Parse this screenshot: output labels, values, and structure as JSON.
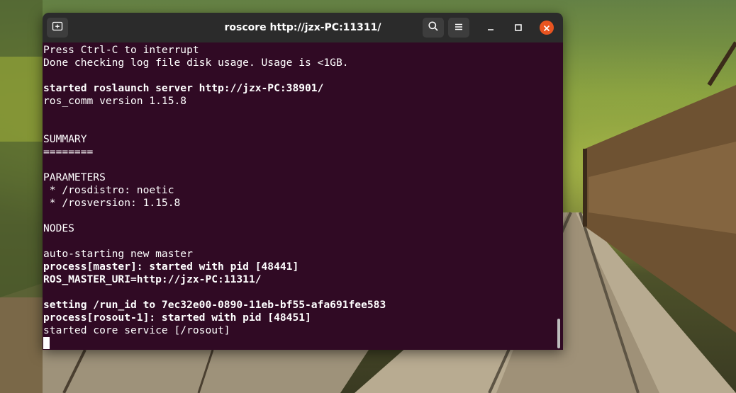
{
  "window": {
    "title": "roscore http://jzx-PC:11311/",
    "new_tab_icon": "new-tab-icon",
    "search_icon": "search-icon",
    "menu_icon": "hamburger-menu-icon",
    "minimize_icon": "minimize-icon",
    "maximize_icon": "maximize-icon",
    "close_icon": "close-icon",
    "close_color": "#e95420"
  },
  "terminal": {
    "background": "#300a24",
    "lines": [
      {
        "text": "Press Ctrl-C to interrupt",
        "bold": false
      },
      {
        "text": "Done checking log file disk usage. Usage is <1GB.",
        "bold": false
      },
      {
        "text": "",
        "bold": false
      },
      {
        "text": "started roslaunch server http://jzx-PC:38901/",
        "bold": true
      },
      {
        "text": "ros_comm version 1.15.8",
        "bold": false
      },
      {
        "text": "",
        "bold": false
      },
      {
        "text": "",
        "bold": false
      },
      {
        "text": "SUMMARY",
        "bold": false
      },
      {
        "text": "========",
        "bold": false
      },
      {
        "text": "",
        "bold": false
      },
      {
        "text": "PARAMETERS",
        "bold": false
      },
      {
        "text": " * /rosdistro: noetic",
        "bold": false
      },
      {
        "text": " * /rosversion: 1.15.8",
        "bold": false
      },
      {
        "text": "",
        "bold": false
      },
      {
        "text": "NODES",
        "bold": false
      },
      {
        "text": "",
        "bold": false
      },
      {
        "text": "auto-starting new master",
        "bold": false
      },
      {
        "text": "process[master]: started with pid [48441]",
        "bold": true
      },
      {
        "text": "ROS_MASTER_URI=http://jzx-PC:11311/",
        "bold": true
      },
      {
        "text": "",
        "bold": false
      },
      {
        "text": "setting /run_id to 7ec32e00-0890-11eb-bf55-afa691fee583",
        "bold": true
      },
      {
        "text": "process[rosout-1]: started with pid [48451]",
        "bold": true
      },
      {
        "text": "started core service [/rosout]",
        "bold": false
      }
    ]
  }
}
